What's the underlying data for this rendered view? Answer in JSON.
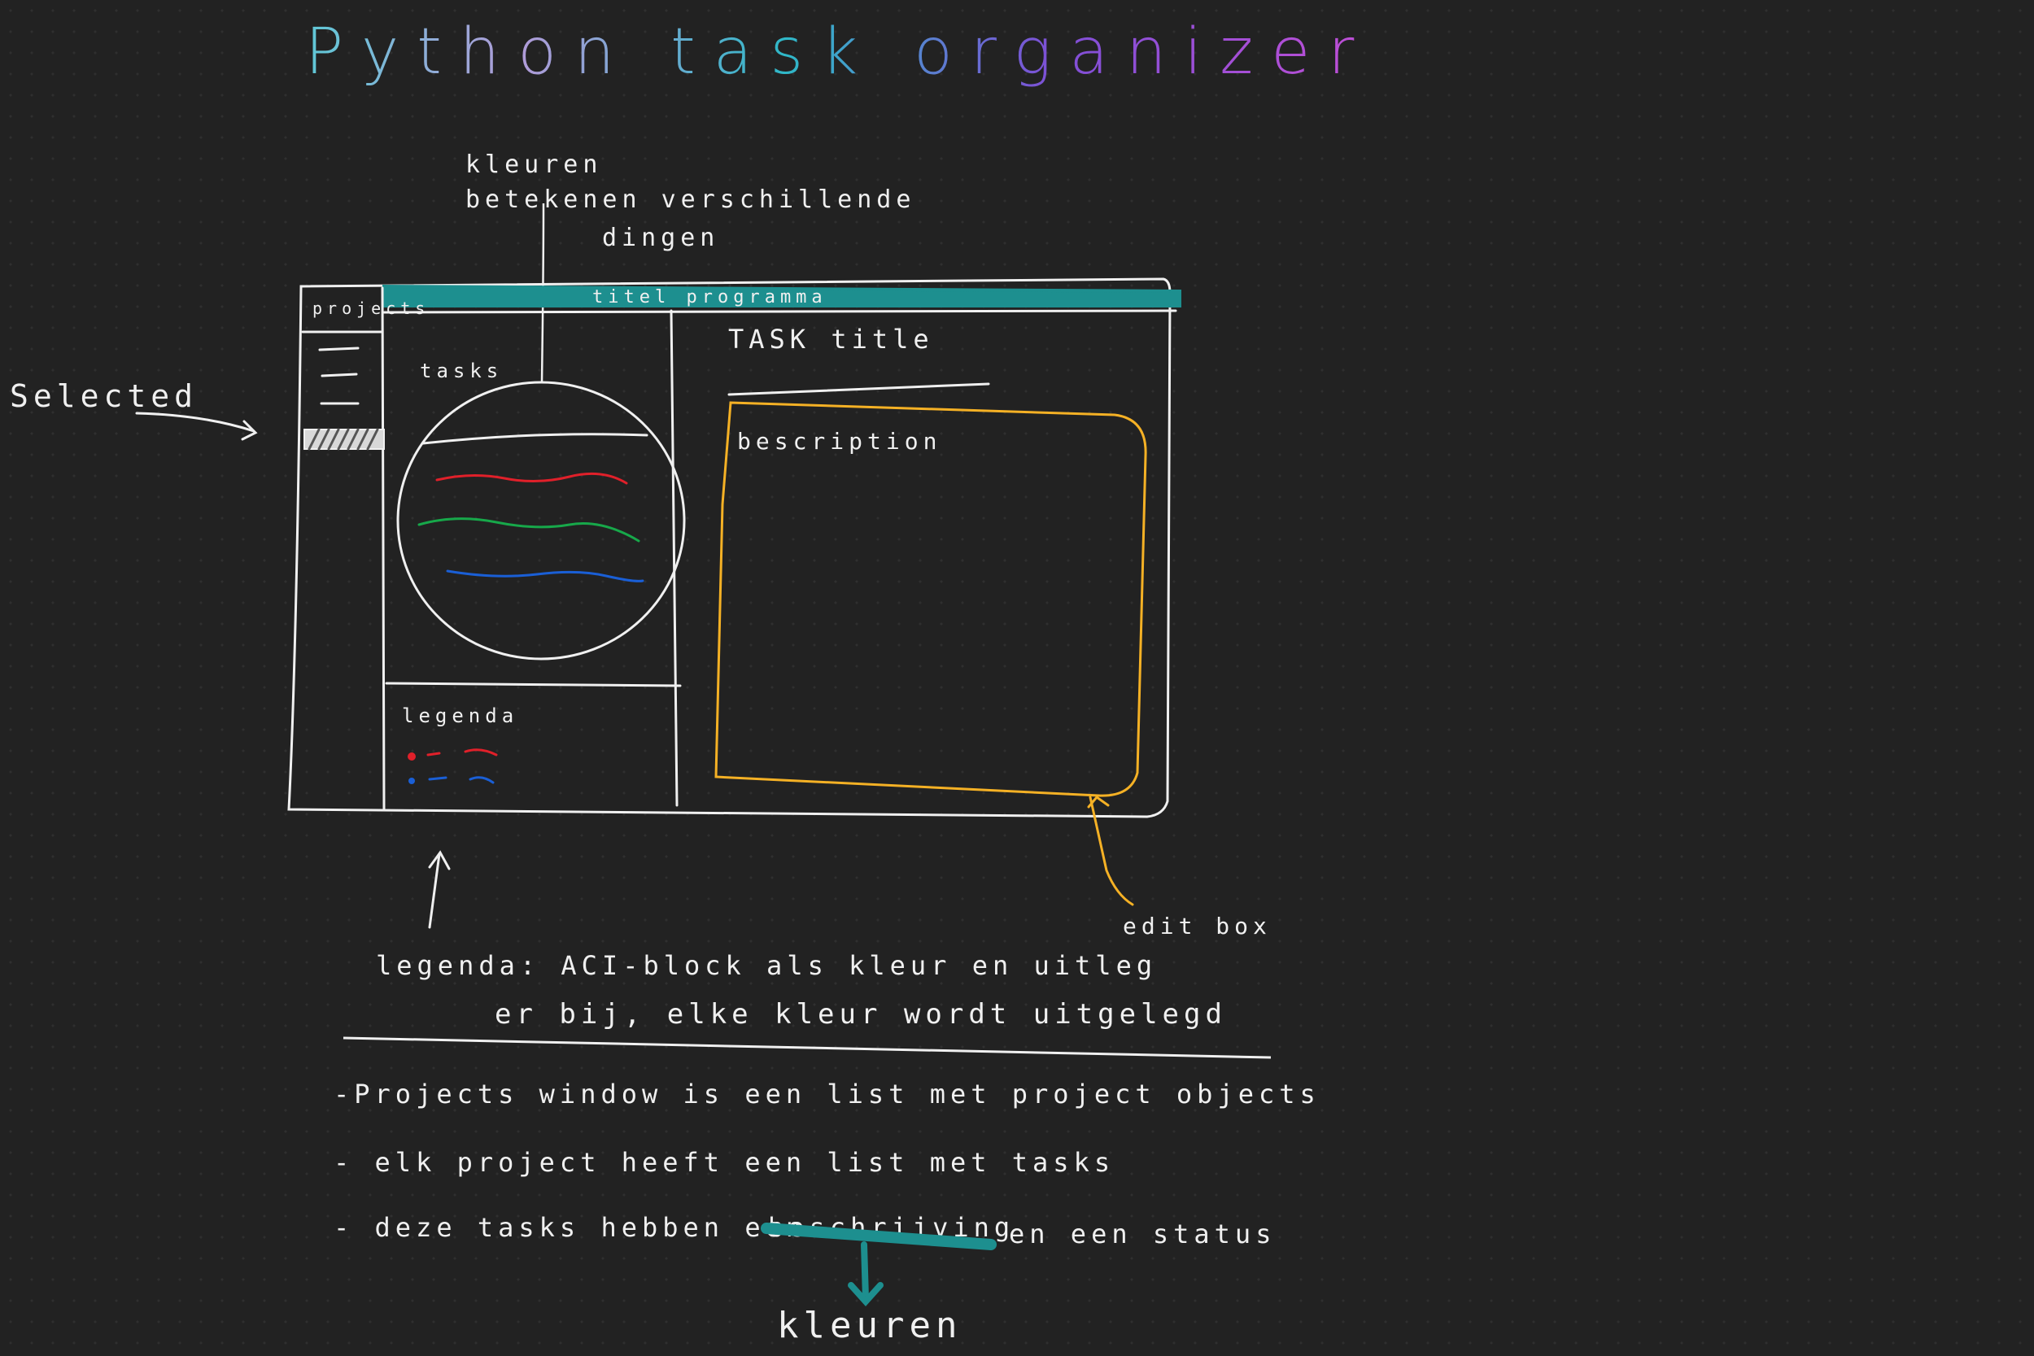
{
  "title": "Python task organizer",
  "annotation_colors": {
    "title": "kleuren betekenen verschillende dingen",
    "lines": [
      "kleuren",
      "betekenen verschillende",
      "dingen"
    ]
  },
  "window": {
    "title_bar": "titel programma",
    "projects_label": "projects",
    "tasks_label": "tasks",
    "task_title": "TASK title",
    "description_label": "bescription",
    "legend_label": "legenda"
  },
  "annotation_selected": "Selected",
  "annotation_edit_box": "edit box",
  "legend_note": {
    "line1": "legenda: ACI-block als kleur en uitleg",
    "line2": "er bij, elke kleur wordt uitgelegd"
  },
  "bullets": [
    "-Projects window is een list met project objects",
    "- elk project heeft een list met tasks",
    "- deze tasks hebben een"
  ],
  "bullet3_struck": "beschrijving",
  "bullet3_tail": "en een status",
  "correction": "kleuren",
  "colors": {
    "accent_teal": "#1d8f8f",
    "edit_box": "#f5b125",
    "task_red": "#e0202a",
    "task_green": "#17a84a",
    "task_blue": "#1a5fd6",
    "correction_gradient": [
      "#f5c418",
      "#9be03a",
      "#2fd07b"
    ]
  }
}
